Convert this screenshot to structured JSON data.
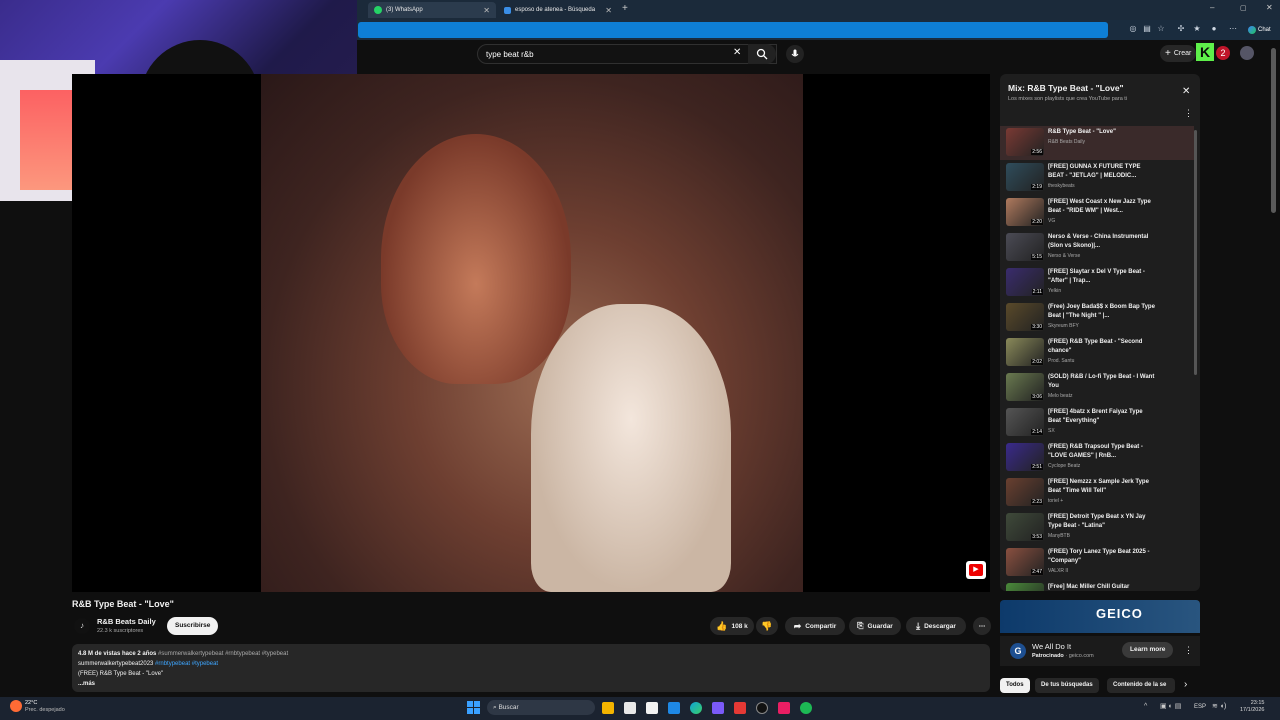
{
  "browser": {
    "tabs": [
      {
        "label": "(3) WhatsApp",
        "active": true
      },
      {
        "label": "esposo de atenea - Búsqueda",
        "active": false
      }
    ],
    "chat_label": "Chat"
  },
  "youtube": {
    "search_value": "type beat r&b",
    "create_label": "Crear",
    "video": {
      "title": "R&B Type Beat - \"Love\"",
      "channel": "R&B Beats Daily",
      "subscribers": "22.3 k suscriptores",
      "subscribe_label": "Suscribirse",
      "likes": "108 k",
      "share_label": "Compartir",
      "save_label": "Guardar",
      "download_label": "Descargar",
      "stats": "4.8 M de vistas  hace 2 años",
      "tags_line1": "#summerwalkertypebeat #rnbtypebeat #typebeat",
      "desc_line2_plain": "summerwalkertypebeat2023",
      "desc_line2_tags": "#rnbtypebeat #typebeat",
      "desc_line3": "(FREE) R&B Type Beat - \"Love\"",
      "more_label": "...más"
    },
    "playlist": {
      "title": "Mix: R&B Type Beat - \"Love\"",
      "subtitle": "Los mixes son playlists que crea YouTube para ti",
      "items": [
        {
          "title": "R&B Type Beat - \"Love\"",
          "channel": "R&B Beats Daily",
          "duration": "2:56",
          "color": "#7a3a34",
          "current": true
        },
        {
          "title": "[FREE] GUNNA X FUTURE TYPE BEAT - \"JETLAG\" | MELODIC...",
          "channel": "theskybeats",
          "duration": "2:19",
          "color": "#2f4d5c"
        },
        {
          "title": "[FREE] West Coast x New Jazz Type Beat - \"RIDE WM\" | West...",
          "channel": "VG",
          "duration": "2:20",
          "color": "#b07a5e"
        },
        {
          "title": "Nerso & Verse - China Instrumental (Slon vs Skono)|...",
          "channel": "Nerso & Verse",
          "duration": "5:15",
          "color": "#4b4b55"
        },
        {
          "title": "[FREE] Slaytar x Del V Type Beat - \"After\" | Trap...",
          "channel": "Yelkin",
          "duration": "2:11",
          "color": "#3a2c6e"
        },
        {
          "title": "(Free) Joey Bada$$ x Boom Bap Type Beat | \"The Night \" |...",
          "channel": "Skyreum BFY",
          "duration": "3:30",
          "color": "#5a4a2a"
        },
        {
          "title": "(FREE) R&B Type Beat - \"Second chance\"",
          "channel": "Prod. Santu",
          "duration": "2:02",
          "color": "#8a8a5a"
        },
        {
          "title": "(SOLD) R&B / Lo-fi Type Beat - I Want You",
          "channel": "Melo beatz",
          "duration": "3:06",
          "color": "#6a7a50"
        },
        {
          "title": "[FREE] 4batz x Brent Faiyaz Type Beat \"Everything\"",
          "channel": "SX",
          "duration": "2:14",
          "color": "#555"
        },
        {
          "title": "(FREE) R&B Trapsoul Type Beat - \"LOVE GAMES\" | RnB...",
          "channel": "Cyclope Beatz",
          "duration": "2:51",
          "color": "#3a2a8c"
        },
        {
          "title": "[FREE] Nemzzz x Sample Jerk Type Beat \"Time Will Tell\"",
          "channel": "toriel +",
          "duration": "2:23",
          "color": "#6a4030"
        },
        {
          "title": "[FREE] Detroit Type Beat x YN Jay Type Beat - \"Latina\"",
          "channel": "ManyBTB",
          "duration": "3:53",
          "color": "#3f4a3a"
        },
        {
          "title": "(FREE) Tory Lanez Type Beat 2025 - \"Company\"",
          "channel": "VALXR II",
          "duration": "2:47",
          "color": "#8a5040"
        },
        {
          "title": "[Free] Mac Miller Chill Guitar",
          "channel": "",
          "duration": "",
          "color": "#4a8a3a"
        }
      ]
    },
    "ad": {
      "brand": "GEICO",
      "headline": "We All Do It",
      "sponsored": "Patrocinado",
      "domain": "geico.com",
      "cta": "Learn more"
    },
    "chips": [
      "Todos",
      "De tus búsquedas",
      "Contenido de la se"
    ]
  },
  "taskbar": {
    "weather_temp": "22°C",
    "weather_desc": "Prec. despejado",
    "search_placeholder": "Buscar",
    "lang": "ESP",
    "time": "23:15",
    "date": "17/1/2026"
  }
}
